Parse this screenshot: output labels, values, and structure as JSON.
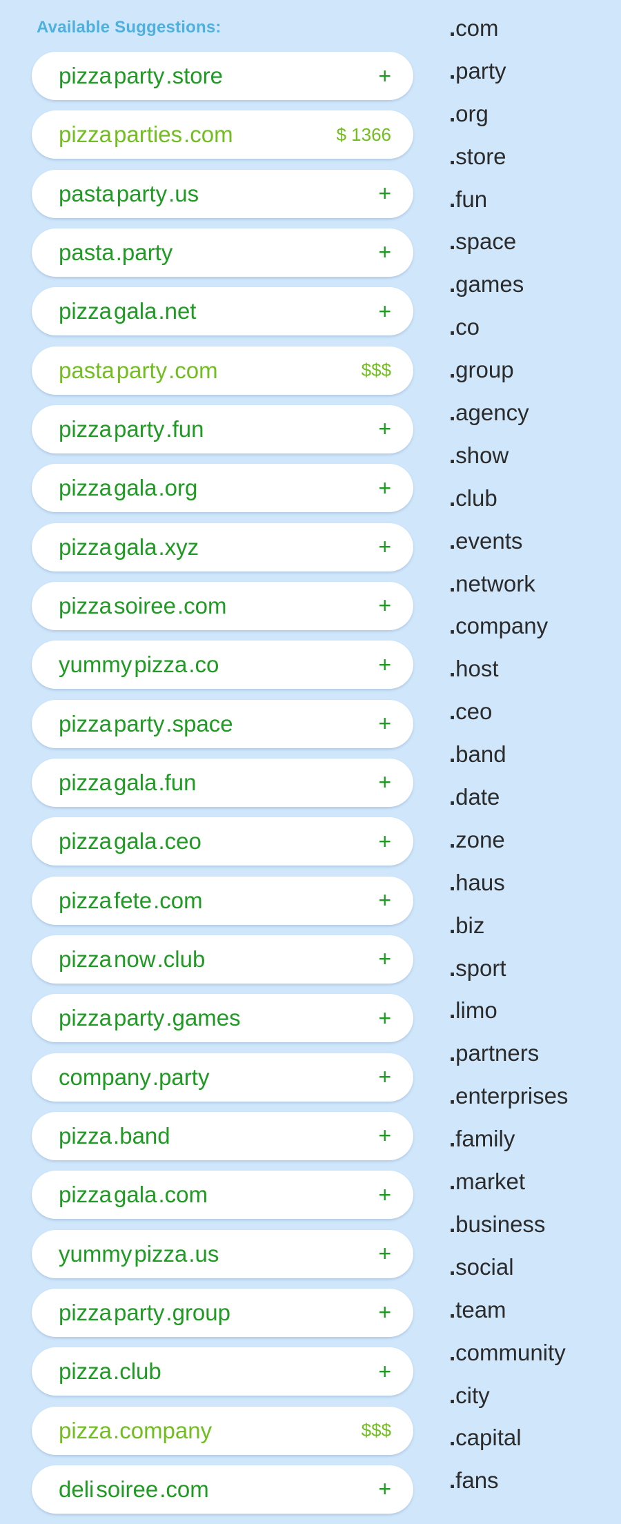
{
  "header": {
    "title": "Available Suggestions:"
  },
  "colors": {
    "background": "#cfe6fb",
    "header_text": "#4fb0de",
    "available_green": "#1f9a23",
    "premium_green": "#72be20",
    "tld_text": "#2b2b2b"
  },
  "suggestions": [
    {
      "base": "pizza",
      "second": "party",
      "tld": ".store",
      "action": "+",
      "premium": false
    },
    {
      "base": "pizza",
      "second": "parties",
      "tld": ".com",
      "action": "$ 1366",
      "premium": true
    },
    {
      "base": "pasta",
      "second": "party",
      "tld": ".us",
      "action": "+",
      "premium": false
    },
    {
      "base": "pasta",
      "second": "",
      "tld": ".party",
      "action": "+",
      "premium": false
    },
    {
      "base": "pizza",
      "second": "gala",
      "tld": ".net",
      "action": "+",
      "premium": false
    },
    {
      "base": "pasta",
      "second": "party",
      "tld": ".com",
      "action": "$$$",
      "premium": true
    },
    {
      "base": "pizza",
      "second": "party",
      "tld": ".fun",
      "action": "+",
      "premium": false
    },
    {
      "base": "pizza",
      "second": "gala",
      "tld": ".org",
      "action": "+",
      "premium": false
    },
    {
      "base": "pizza",
      "second": "gala",
      "tld": ".xyz",
      "action": "+",
      "premium": false
    },
    {
      "base": "pizza",
      "second": "soiree",
      "tld": ".com",
      "action": "+",
      "premium": false
    },
    {
      "base": "yummy",
      "second": "pizza",
      "tld": ".co",
      "action": "+",
      "premium": false
    },
    {
      "base": "pizza",
      "second": "party",
      "tld": ".space",
      "action": "+",
      "premium": false
    },
    {
      "base": "pizza",
      "second": "gala",
      "tld": ".fun",
      "action": "+",
      "premium": false
    },
    {
      "base": "pizza",
      "second": "gala",
      "tld": ".ceo",
      "action": "+",
      "premium": false
    },
    {
      "base": "pizza",
      "second": "fete",
      "tld": ".com",
      "action": "+",
      "premium": false
    },
    {
      "base": "pizza",
      "second": "now",
      "tld": ".club",
      "action": "+",
      "premium": false
    },
    {
      "base": "pizza",
      "second": "party",
      "tld": ".games",
      "action": "+",
      "premium": false
    },
    {
      "base": "company",
      "second": "",
      "tld": ".party",
      "action": "+",
      "premium": false
    },
    {
      "base": "pizza",
      "second": "",
      "tld": ".band",
      "action": "+",
      "premium": false
    },
    {
      "base": "pizza",
      "second": "gala",
      "tld": ".com",
      "action": "+",
      "premium": false
    },
    {
      "base": "yummy",
      "second": "pizza",
      "tld": ".us",
      "action": "+",
      "premium": false
    },
    {
      "base": "pizza",
      "second": "party",
      "tld": ".group",
      "action": "+",
      "premium": false
    },
    {
      "base": "pizza",
      "second": "",
      "tld": ".club",
      "action": "+",
      "premium": false
    },
    {
      "base": "pizza",
      "second": "",
      "tld": ".company",
      "action": "$$$",
      "premium": true
    },
    {
      "base": "deli",
      "second": "soiree",
      "tld": ".com",
      "action": "+",
      "premium": false
    }
  ],
  "tld_list": [
    "com",
    "party",
    "org",
    "store",
    "fun",
    "space",
    "games",
    "co",
    "group",
    "agency",
    "show",
    "club",
    "events",
    "network",
    "company",
    "host",
    "ceo",
    "band",
    "date",
    "zone",
    "haus",
    "biz",
    "sport",
    "limo",
    "partners",
    "enterprises",
    "family",
    "market",
    "business",
    "social",
    "team",
    "community",
    "city",
    "capital",
    "fans"
  ]
}
